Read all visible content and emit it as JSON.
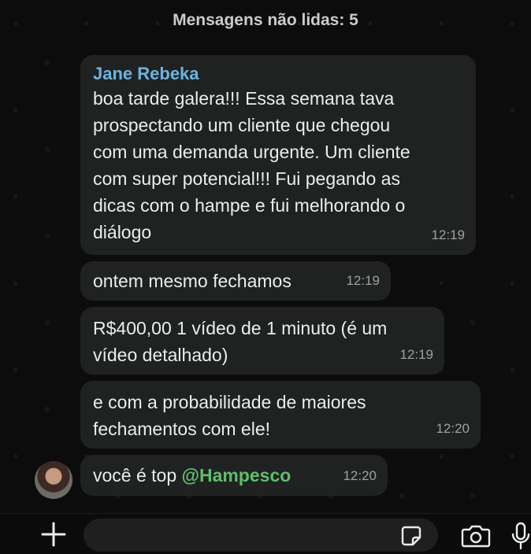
{
  "unread_banner": "Mensagens não lidas: 5",
  "messages": [
    {
      "sender": "Jane Rebeka",
      "lines": [
        "boa tarde galera!!! Essa semana tava",
        "prospectando um cliente que chegou",
        "com uma demanda urgente. Um cliente",
        "com super potencial!!! Fui pegando as",
        "dicas com o hampe e fui melhorando o",
        "diálogo"
      ],
      "time": "12:19"
    },
    {
      "text": "ontem mesmo fechamos",
      "time": "12:19"
    },
    {
      "lines": [
        "R$400,00 1 vídeo de 1 minuto (é um",
        "vídeo detalhado)"
      ],
      "time": "12:19"
    },
    {
      "lines": [
        "e com a probabilidade de maiores",
        "fechamentos com ele!"
      ],
      "time": "12:20"
    },
    {
      "text_prefix": "você é top ",
      "mention": "@Hampesco",
      "time": "12:20"
    }
  ],
  "composer": {
    "plus_icon": "plus-icon",
    "input_placeholder": "",
    "sticker_icon": "sticker-icon",
    "camera_icon": "camera-icon",
    "mic_icon": "microphone-icon"
  },
  "colors": {
    "bubble": "#202222",
    "sender": "#6cb4e0",
    "mention": "#5fbf6a",
    "time": "#9aa0a3"
  }
}
